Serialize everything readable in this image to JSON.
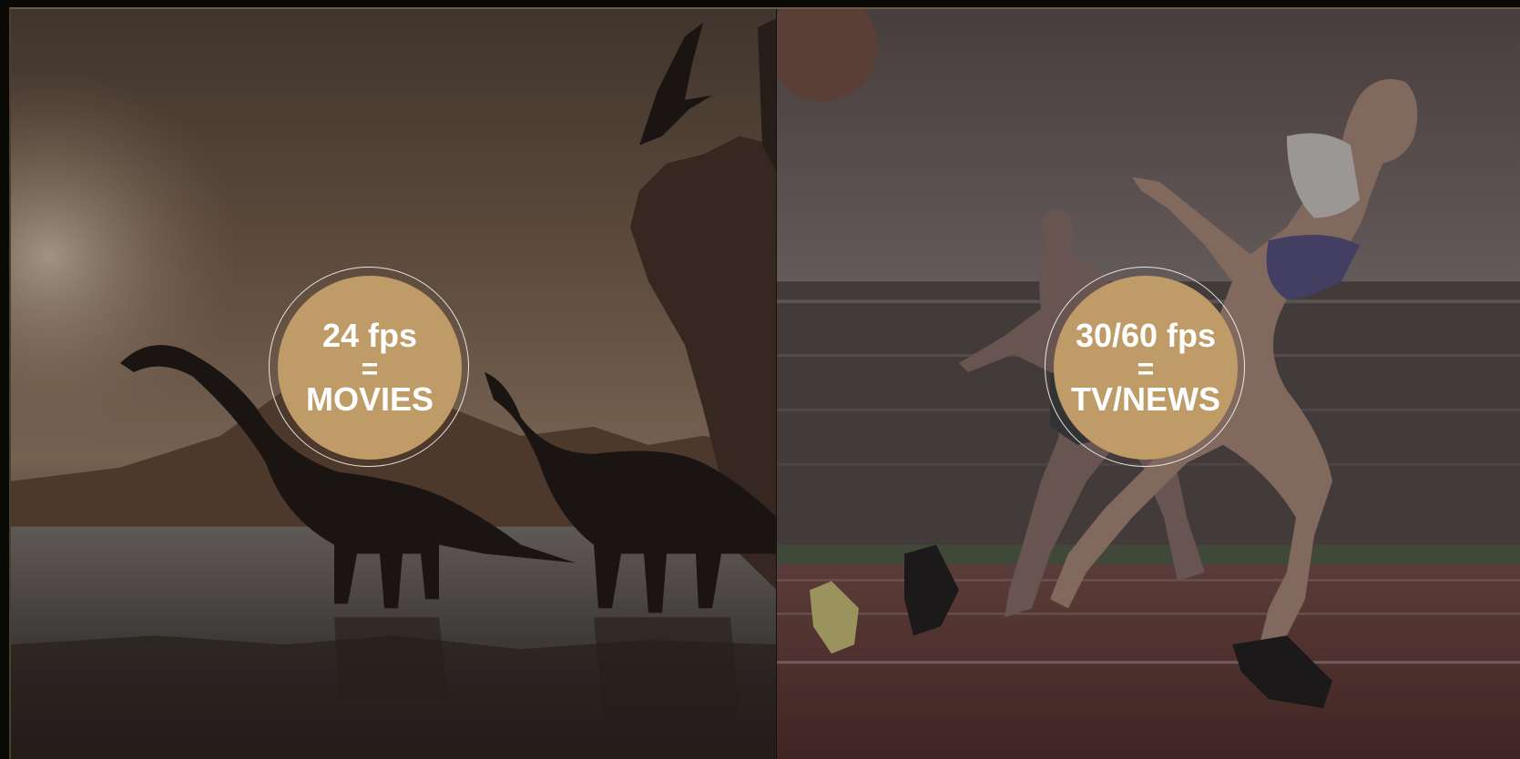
{
  "panels": [
    {
      "name": "movies",
      "badge": {
        "line1": "24 fps",
        "line2": "=",
        "line3": "MOVIES"
      },
      "scene": "dinosaurs at a lake under a hazy sky"
    },
    {
      "name": "tv-news",
      "badge": {
        "line1": "30/60 fps",
        "line2": "=",
        "line3": "TV/NEWS"
      },
      "scene": "sprinters running on a stadium track"
    }
  ],
  "colors": {
    "badge_fill": "#bf9b68",
    "badge_ring": "#ffffff",
    "left_tone": "#6e5a44",
    "right_tone": "#5e5452"
  }
}
